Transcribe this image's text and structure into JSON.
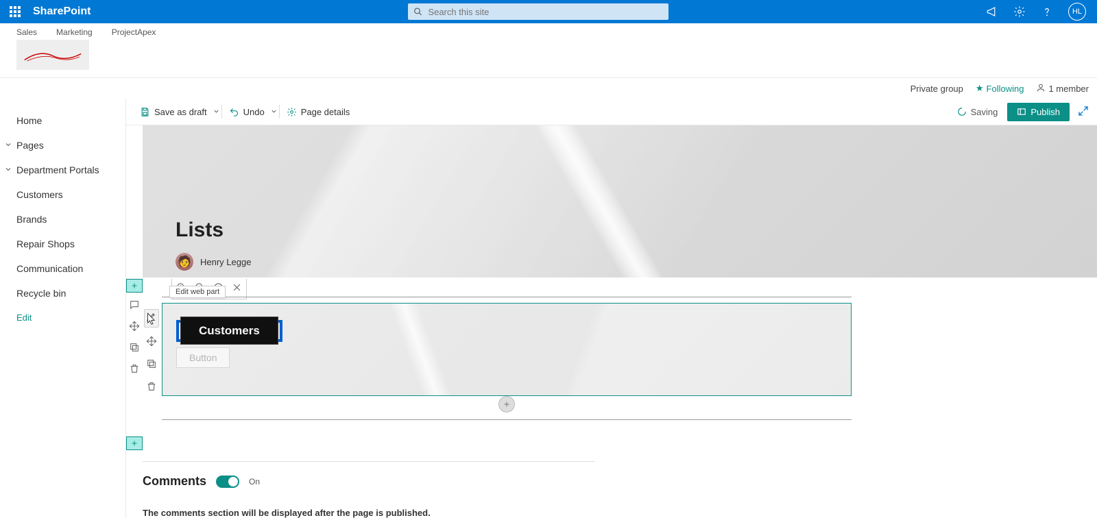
{
  "suite": {
    "brand": "SharePoint",
    "search_placeholder": "Search this site",
    "avatar_initials": "HL"
  },
  "hub_links": [
    "Sales",
    "Marketing",
    "ProjectApex"
  ],
  "status": {
    "group_type": "Private group",
    "following": "Following",
    "members": "1 member"
  },
  "sidebar": {
    "home": "Home",
    "pages": "Pages",
    "dept": "Department Portals",
    "customers": "Customers",
    "brands": "Brands",
    "repair": "Repair Shops",
    "comm": "Communication",
    "recycle": "Recycle bin",
    "edit": "Edit"
  },
  "cmd": {
    "save_draft": "Save as draft",
    "undo": "Undo",
    "page_details": "Page details",
    "saving": "Saving",
    "publish": "Publish"
  },
  "hero": {
    "title": "Lists",
    "author": "Henry Legge"
  },
  "tooltip": {
    "edit_webpart": "Edit web part"
  },
  "webpart": {
    "button_primary": "Customers",
    "button_ghost": "Button"
  },
  "comments": {
    "title": "Comments",
    "toggle_label": "On",
    "note": "The comments section will be displayed after the page is published."
  }
}
